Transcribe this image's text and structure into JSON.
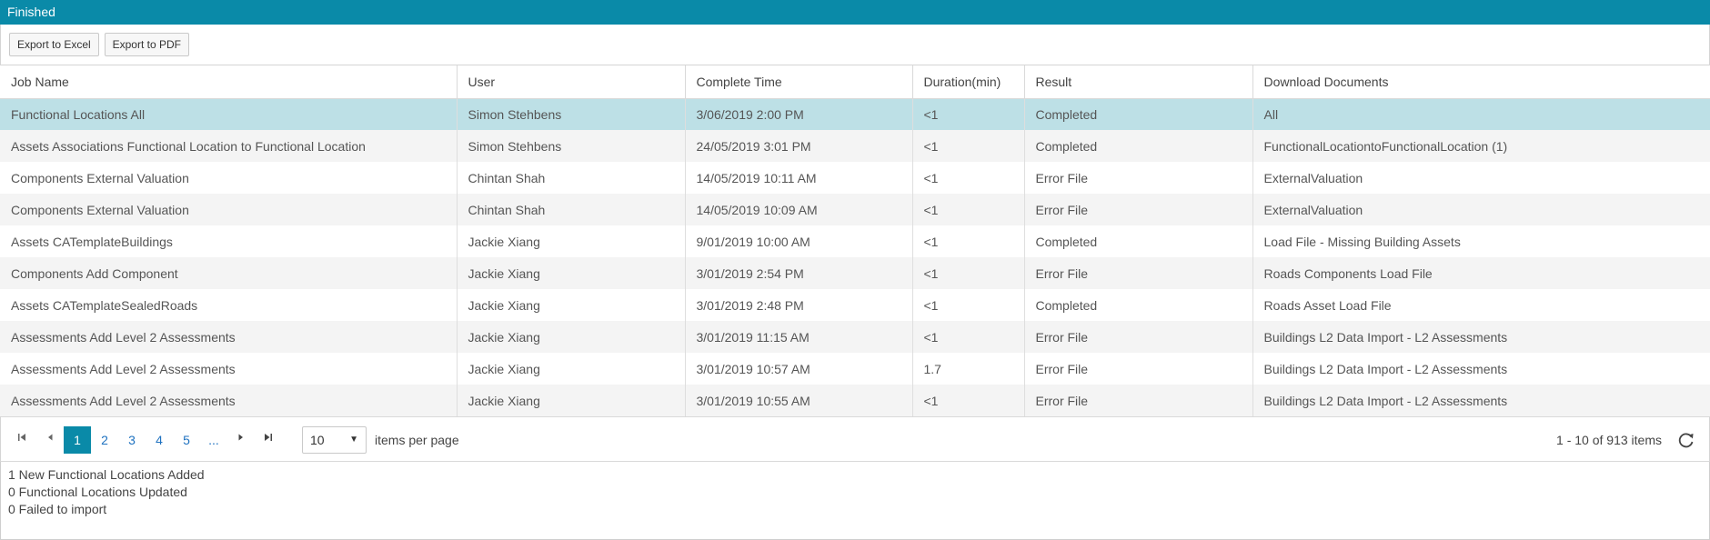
{
  "title": "Finished",
  "toolbar": {
    "export_excel": "Export to Excel",
    "export_pdf": "Export to PDF"
  },
  "columns": [
    "Job Name",
    "User",
    "Complete Time",
    "Duration(min)",
    "Result",
    "Download Documents"
  ],
  "rows": [
    {
      "job": "Functional Locations All",
      "user": "Simon Stehbens",
      "time": "3/06/2019 2:00 PM",
      "duration": "<1",
      "result": "Completed",
      "download": "All"
    },
    {
      "job": "Assets Associations Functional Location to Functional Location",
      "user": "Simon Stehbens",
      "time": "24/05/2019 3:01 PM",
      "duration": "<1",
      "result": "Completed",
      "download": "FunctionalLocationtoFunctionalLocation (1)"
    },
    {
      "job": "Components External Valuation",
      "user": "Chintan Shah",
      "time": "14/05/2019 10:11 AM",
      "duration": "<1",
      "result": "Error File",
      "download": "ExternalValuation"
    },
    {
      "job": "Components External Valuation",
      "user": "Chintan Shah",
      "time": "14/05/2019 10:09 AM",
      "duration": "<1",
      "result": "Error File",
      "download": "ExternalValuation"
    },
    {
      "job": "Assets CATemplateBuildings",
      "user": "Jackie Xiang",
      "time": "9/01/2019 10:00 AM",
      "duration": "<1",
      "result": "Completed",
      "download": "Load File - Missing Building Assets"
    },
    {
      "job": "Components Add Component",
      "user": "Jackie Xiang",
      "time": "3/01/2019 2:54 PM",
      "duration": "<1",
      "result": "Error File",
      "download": "Roads Components Load File"
    },
    {
      "job": "Assets CATemplateSealedRoads",
      "user": "Jackie Xiang",
      "time": "3/01/2019 2:48 PM",
      "duration": "<1",
      "result": "Completed",
      "download": "Roads Asset Load File"
    },
    {
      "job": "Assessments Add Level 2 Assessments",
      "user": "Jackie Xiang",
      "time": "3/01/2019 11:15 AM",
      "duration": "<1",
      "result": "Error File",
      "download": "Buildings L2 Data Import - L2 Assessments"
    },
    {
      "job": "Assessments Add Level 2 Assessments",
      "user": "Jackie Xiang",
      "time": "3/01/2019 10:57 AM",
      "duration": "1.7",
      "result": "Error File",
      "download": "Buildings L2 Data Import - L2 Assessments"
    },
    {
      "job": "Assessments Add Level 2 Assessments",
      "user": "Jackie Xiang",
      "time": "3/01/2019 10:55 AM",
      "duration": "<1",
      "result": "Error File",
      "download": "Buildings L2 Data Import - L2 Assessments"
    }
  ],
  "selected_row": 0,
  "pager": {
    "pages": [
      "1",
      "2",
      "3",
      "4",
      "5",
      "..."
    ],
    "current": "1",
    "per_page": "10",
    "per_page_label": "items per page",
    "info": "1 - 10 of 913 items",
    "icons": {
      "first": "first-page-icon",
      "prev": "prev-page-icon",
      "next": "next-page-icon",
      "last": "last-page-icon",
      "refresh": "refresh-icon"
    }
  },
  "log": [
    "1 New Functional Locations Added",
    "0 Functional Locations Updated",
    "0 Failed to import"
  ],
  "colors": {
    "accent": "#0a8aa8",
    "link": "#1f72c0",
    "selected": "#bde0e6",
    "alt_row": "#f4f4f4",
    "muted": "#999999"
  }
}
